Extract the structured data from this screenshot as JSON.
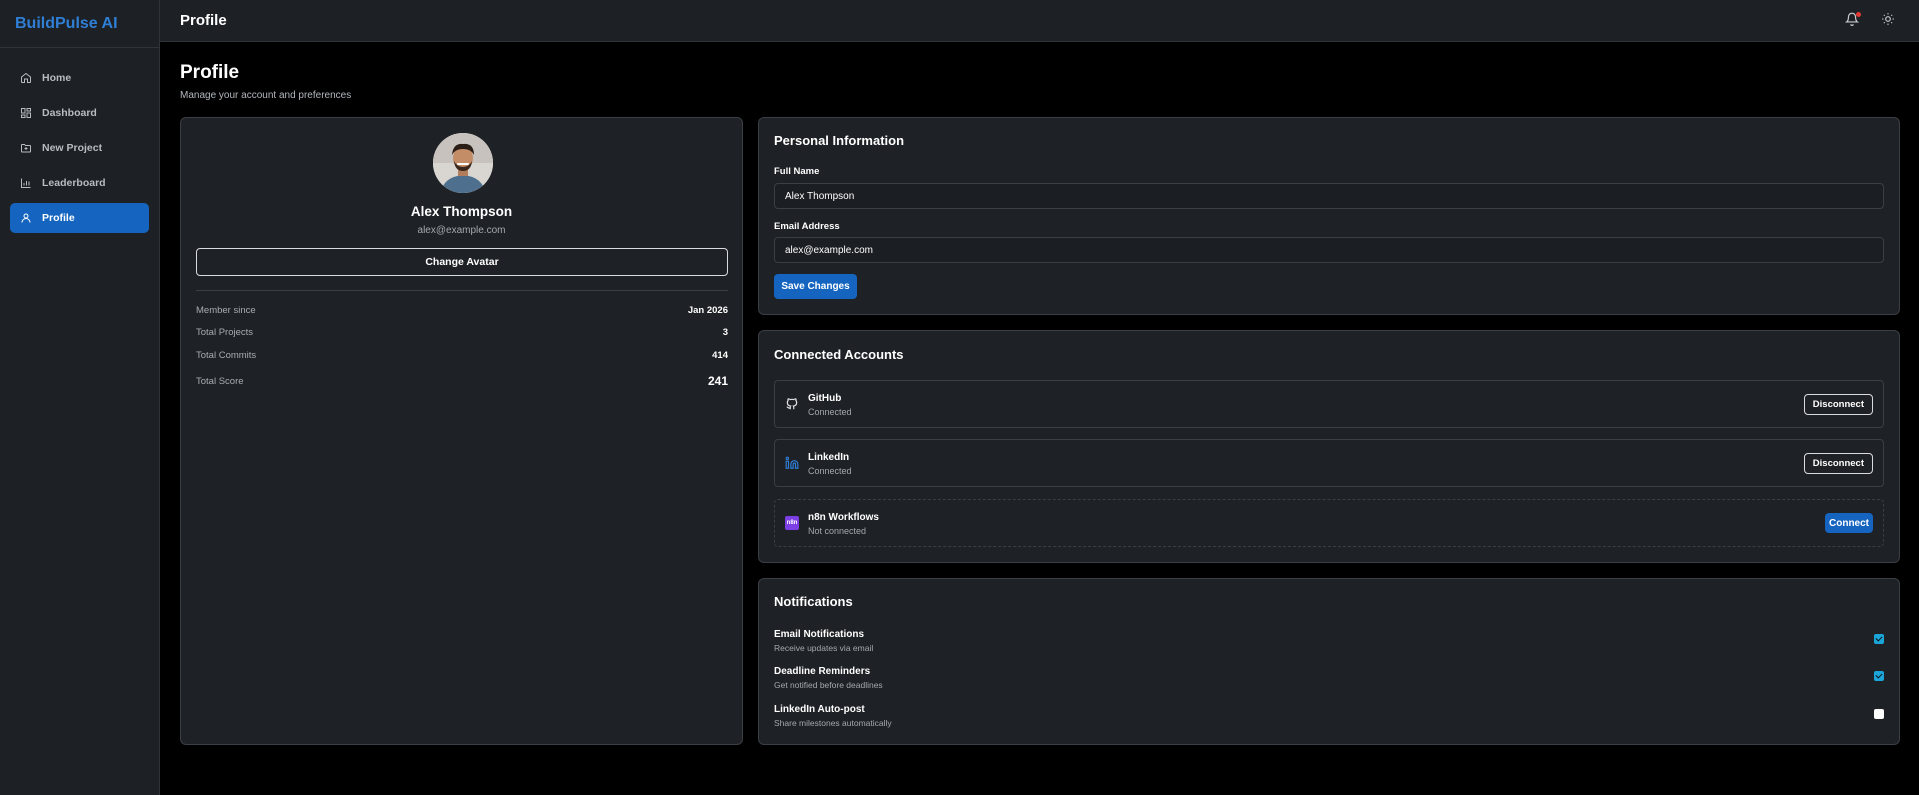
{
  "brand": "BuildPulse AI",
  "sidebar": {
    "items": [
      {
        "label": "Home",
        "icon": "home-icon"
      },
      {
        "label": "Dashboard",
        "icon": "dashboard-icon"
      },
      {
        "label": "New Project",
        "icon": "folder-plus-icon"
      },
      {
        "label": "Leaderboard",
        "icon": "bar-chart-icon"
      },
      {
        "label": "Profile",
        "icon": "user-icon",
        "active": true
      }
    ]
  },
  "header": {
    "title": "Profile",
    "icons": [
      "bell-icon",
      "sun-icon"
    ]
  },
  "page": {
    "title": "Profile",
    "subtitle": "Manage your account and preferences"
  },
  "profile": {
    "name": "Alex Thompson",
    "email": "alex@example.com",
    "change_avatar_label": "Change Avatar",
    "stats": [
      {
        "label": "Member since",
        "value": "Jan 2026"
      },
      {
        "label": "Total Projects",
        "value": "3"
      },
      {
        "label": "Total Commits",
        "value": "414"
      },
      {
        "label": "Total Score",
        "value": "241"
      }
    ]
  },
  "personal_info": {
    "title": "Personal Information",
    "full_name_label": "Full Name",
    "full_name_value": "Alex Thompson",
    "email_label": "Email Address",
    "email_value": "alex@example.com",
    "save_label": "Save Changes"
  },
  "connected_accounts": {
    "title": "Connected Accounts",
    "items": [
      {
        "name": "GitHub",
        "status": "Connected",
        "action": "Disconnect",
        "icon": "github-icon"
      },
      {
        "name": "LinkedIn",
        "status": "Connected",
        "action": "Disconnect",
        "icon": "linkedin-icon"
      },
      {
        "name": "n8n Workflows",
        "status": "Not connected",
        "action": "Connect",
        "icon": "n8n-icon",
        "icon_text": "n8n"
      }
    ]
  },
  "notifications": {
    "title": "Notifications",
    "items": [
      {
        "title": "Email Notifications",
        "desc": "Receive updates via email",
        "checked": true
      },
      {
        "title": "Deadline Reminders",
        "desc": "Get notified before deadlines",
        "checked": true
      },
      {
        "title": "LinkedIn Auto-post",
        "desc": "Share milestones automatically",
        "checked": false
      }
    ]
  },
  "colors": {
    "accent": "#1565c0",
    "brand": "#2f7fd6",
    "checkbox_on": "#1aa6d8",
    "badge": "#e53935",
    "n8n": "#7b3fe4"
  }
}
